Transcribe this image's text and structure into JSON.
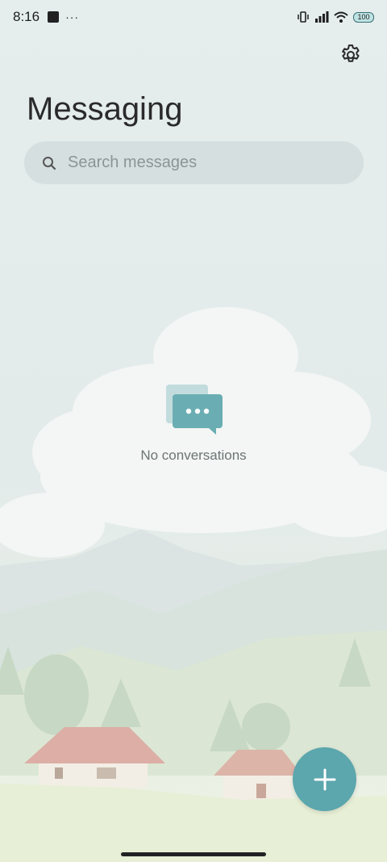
{
  "status_bar": {
    "time": "8:16",
    "dots": "···",
    "battery": "100"
  },
  "header": {
    "title": "Messaging"
  },
  "search": {
    "placeholder": "Search messages"
  },
  "empty_state": {
    "label": "No conversations"
  },
  "colors": {
    "accent": "#5ca6ad",
    "background": "#e4ecec",
    "search_bg": "#d5dfdf"
  },
  "icons": {
    "settings": "gear-icon",
    "search": "search-icon",
    "empty": "chat-bubbles-icon",
    "fab": "plus-icon"
  }
}
